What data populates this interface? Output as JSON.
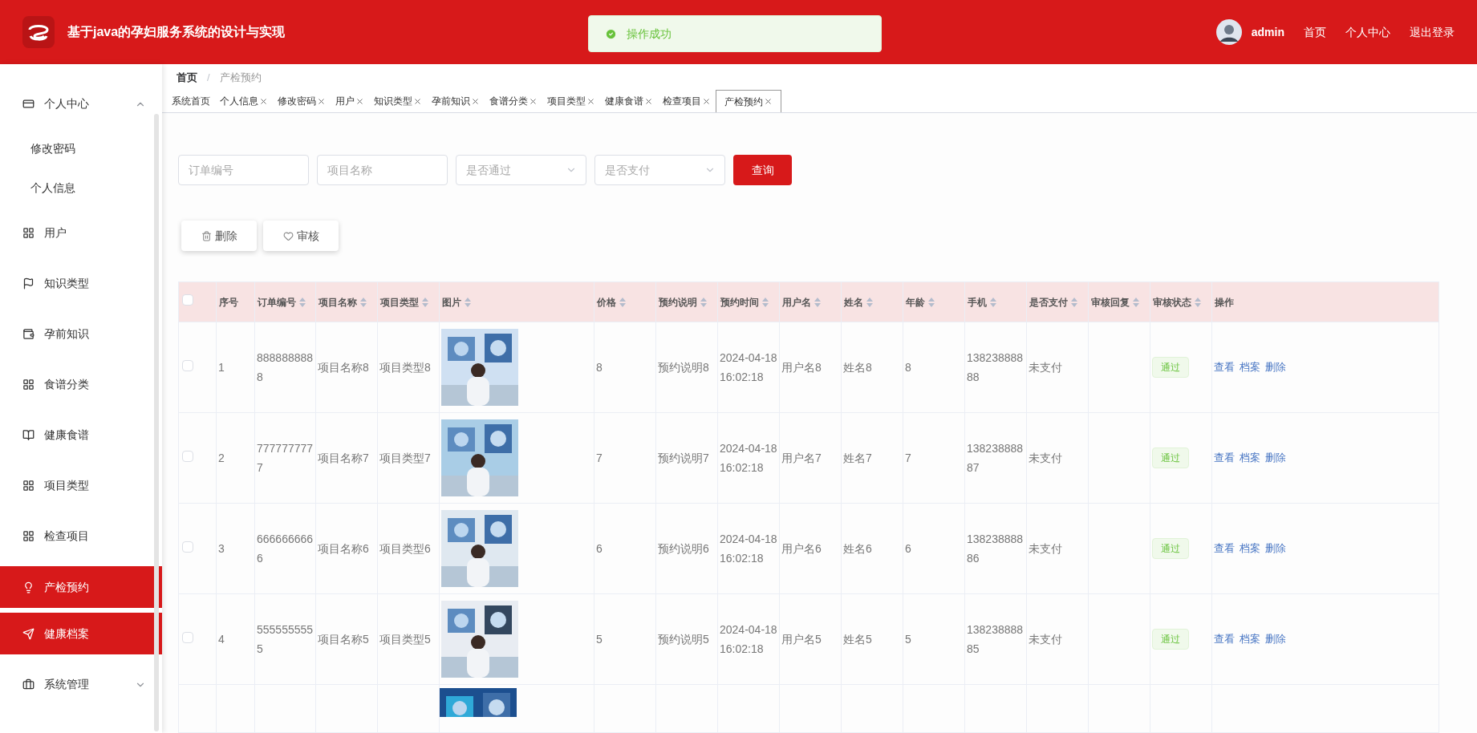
{
  "header": {
    "title": "基于java的孕妇服务系统的设计与实现",
    "user": "admin",
    "links": [
      "首页",
      "个人中心",
      "退出登录"
    ]
  },
  "toast": {
    "kind": "success",
    "message": "操作成功"
  },
  "sidebar": {
    "items": [
      {
        "label": "个人中心",
        "selected": false,
        "expanded": true,
        "children": [
          {
            "label": "修改密码",
            "selected": false
          },
          {
            "label": "个人信息",
            "selected": false
          }
        ]
      },
      {
        "label": "用户",
        "selected": false
      },
      {
        "label": "知识类型",
        "selected": false
      },
      {
        "label": "孕前知识",
        "selected": false
      },
      {
        "label": "食谱分类",
        "selected": false
      },
      {
        "label": "健康食谱",
        "selected": false
      },
      {
        "label": "项目类型",
        "selected": false
      },
      {
        "label": "检查项目",
        "selected": false
      },
      {
        "label": "产检预约",
        "selected": true
      },
      {
        "label": "健康档案",
        "selected": true
      },
      {
        "label": "系统管理",
        "selected": false,
        "expanded": false
      }
    ]
  },
  "breadcrumb": [
    "首页",
    "产检预约"
  ],
  "breadcrumb_separator": "/",
  "tabs": [
    {
      "label": "系统首页",
      "closable": false,
      "selected": false
    },
    {
      "label": "个人信息",
      "closable": true,
      "selected": false
    },
    {
      "label": "修改密码",
      "closable": true,
      "selected": false
    },
    {
      "label": "用户",
      "closable": true,
      "selected": false
    },
    {
      "label": "知识类型",
      "closable": true,
      "selected": false
    },
    {
      "label": "孕前知识",
      "closable": true,
      "selected": false
    },
    {
      "label": "食谱分类",
      "closable": true,
      "selected": false
    },
    {
      "label": "项目类型",
      "closable": true,
      "selected": false
    },
    {
      "label": "健康食谱",
      "closable": true,
      "selected": false
    },
    {
      "label": "检查项目",
      "closable": true,
      "selected": false
    },
    {
      "label": "产检预约",
      "closable": true,
      "selected": true
    }
  ],
  "filters": [
    {
      "kind": "input",
      "placeholder": "订单编号"
    },
    {
      "kind": "input",
      "placeholder": "项目名称"
    },
    {
      "kind": "select",
      "placeholder": "是否通过"
    },
    {
      "kind": "select",
      "placeholder": "是否支付"
    }
  ],
  "search_button": "查询",
  "actions": [
    {
      "kind": "delete",
      "label": "删除"
    },
    {
      "kind": "audit",
      "label": "审核"
    }
  ],
  "table": {
    "select_all": {
      "checked": false
    },
    "columns": [
      {
        "label": "序号",
        "sortable": false
      },
      {
        "label": "订单编号",
        "sortable": true
      },
      {
        "label": "项目名称",
        "sortable": true
      },
      {
        "label": "项目类型",
        "sortable": true
      },
      {
        "label": "图片",
        "sortable": true
      },
      {
        "label": "价格",
        "sortable": true
      },
      {
        "label": "预约说明",
        "sortable": true
      },
      {
        "label": "预约时间",
        "sortable": true
      },
      {
        "label": "用户名",
        "sortable": true
      },
      {
        "label": "姓名",
        "sortable": true
      },
      {
        "label": "年龄",
        "sortable": true
      },
      {
        "label": "手机",
        "sortable": true
      },
      {
        "label": "是否支付",
        "sortable": true
      },
      {
        "label": "审核回复",
        "sortable": true
      },
      {
        "label": "审核状态",
        "sortable": true
      },
      {
        "label": "操作",
        "sortable": false
      }
    ],
    "rows": [
      {
        "checked": false,
        "cells": [
          "1",
          "8888888888",
          "项目名称8",
          "项目类型8",
          null,
          "8",
          "预约说明8",
          "2024-04-18 16:02:18",
          "用户名8",
          "姓名8",
          "8",
          "13823888888",
          "未支付",
          ""
        ],
        "status": "通过",
        "actions": [
          "查看",
          "档案",
          "删除"
        ]
      },
      {
        "checked": false,
        "cells": [
          "2",
          "7777777777",
          "项目名称7",
          "项目类型7",
          null,
          "7",
          "预约说明7",
          "2024-04-18 16:02:18",
          "用户名7",
          "姓名7",
          "7",
          "13823888887",
          "未支付",
          ""
        ],
        "status": "通过",
        "actions": [
          "查看",
          "档案",
          "删除"
        ]
      },
      {
        "checked": false,
        "cells": [
          "3",
          "6666666666",
          "项目名称6",
          "项目类型6",
          null,
          "6",
          "预约说明6",
          "2024-04-18 16:02:18",
          "用户名6",
          "姓名6",
          "6",
          "13823888886",
          "未支付",
          ""
        ],
        "status": "通过",
        "actions": [
          "查看",
          "档案",
          "删除"
        ]
      },
      {
        "checked": false,
        "cells": [
          "4",
          "5555555555",
          "项目名称5",
          "项目类型5",
          null,
          "5",
          "预约说明5",
          "2024-04-18 16:02:18",
          "用户名5",
          "姓名5",
          "5",
          "13823888885",
          "未支付",
          ""
        ],
        "status": "通过",
        "actions": [
          "查看",
          "档案",
          "删除"
        ]
      }
    ]
  }
}
